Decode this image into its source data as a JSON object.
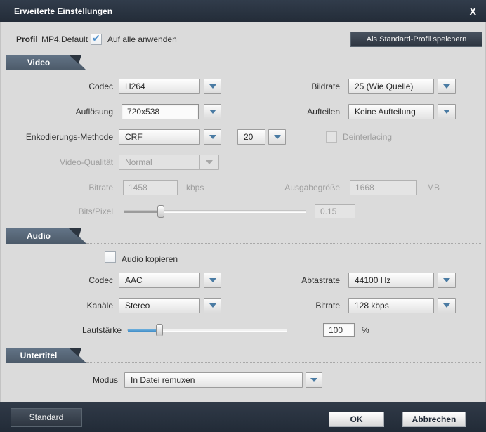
{
  "dialog": {
    "title": "Erweiterte Einstellungen",
    "close_glyph": "X"
  },
  "icons": {
    "check": "✔"
  },
  "colors": {
    "titlebar": "#28313f",
    "content_bg": "#dbdbdb",
    "section_tab": "#56677a",
    "accent_blue": "#4f9bd5",
    "dark_button": "#39434f"
  },
  "profile": {
    "label": "Profil",
    "value": "MP4.Default",
    "apply_all_label": "Auf alle anwenden",
    "apply_all_checked": true,
    "save_button": "Als Standard-Profil speichern"
  },
  "sections": {
    "video": {
      "label": "Video",
      "codec_label": "Codec",
      "codec_value": "H264",
      "bildrate_label": "Bildrate",
      "bildrate_value": "25 (Wie Quelle)",
      "aufloesung_label": "Auflösung",
      "aufloesung_value": "720x538",
      "aufteilen_label": "Aufteilen",
      "aufteilen_value": "Keine Aufteilung",
      "enkodierung_label": "Enkodierungs-Methode",
      "enkodierung_value": "CRF",
      "crf_value": "20",
      "deinterlacing_label": "Deinterlacing",
      "deinterlacing_checked": false,
      "qualitaet_label": "Video-Qualität",
      "qualitaet_value": "Normal",
      "bitrate_label": "Bitrate",
      "bitrate_value": "1458",
      "bitrate_unit": "kbps",
      "ausgabe_label": "Ausgabegröße",
      "ausgabe_value": "1668",
      "ausgabe_unit": "MB",
      "bitspixel_label": "Bits/Pixel",
      "bitspixel_value": "0.15",
      "bitspixel_slider_percent": 20,
      "disabled_controls": [
        "deinterlacing",
        "qualitaet",
        "bitrate",
        "ausgabegroesse",
        "bitspixel"
      ]
    },
    "audio": {
      "label": "Audio",
      "copy_label": "Audio kopieren",
      "copy_checked": false,
      "codec_label": "Codec",
      "codec_value": "AAC",
      "abtastrate_label": "Abtastrate",
      "abtastrate_value": "44100 Hz",
      "kanaele_label": "Kanäle",
      "kanaele_value": "Stereo",
      "bitrate_label": "Bitrate",
      "bitrate_value": "128 kbps",
      "lautstaerke_label": "Lautstärke",
      "lautstaerke_value": "100",
      "lautstaerke_unit": "%",
      "lautstaerke_slider_percent": 20
    },
    "untertitel": {
      "label": "Untertitel",
      "modus_label": "Modus",
      "modus_value": "In Datei remuxen"
    }
  },
  "footer": {
    "standard_button": "Standard",
    "ok_button": "OK",
    "cancel_button": "Abbrechen"
  }
}
